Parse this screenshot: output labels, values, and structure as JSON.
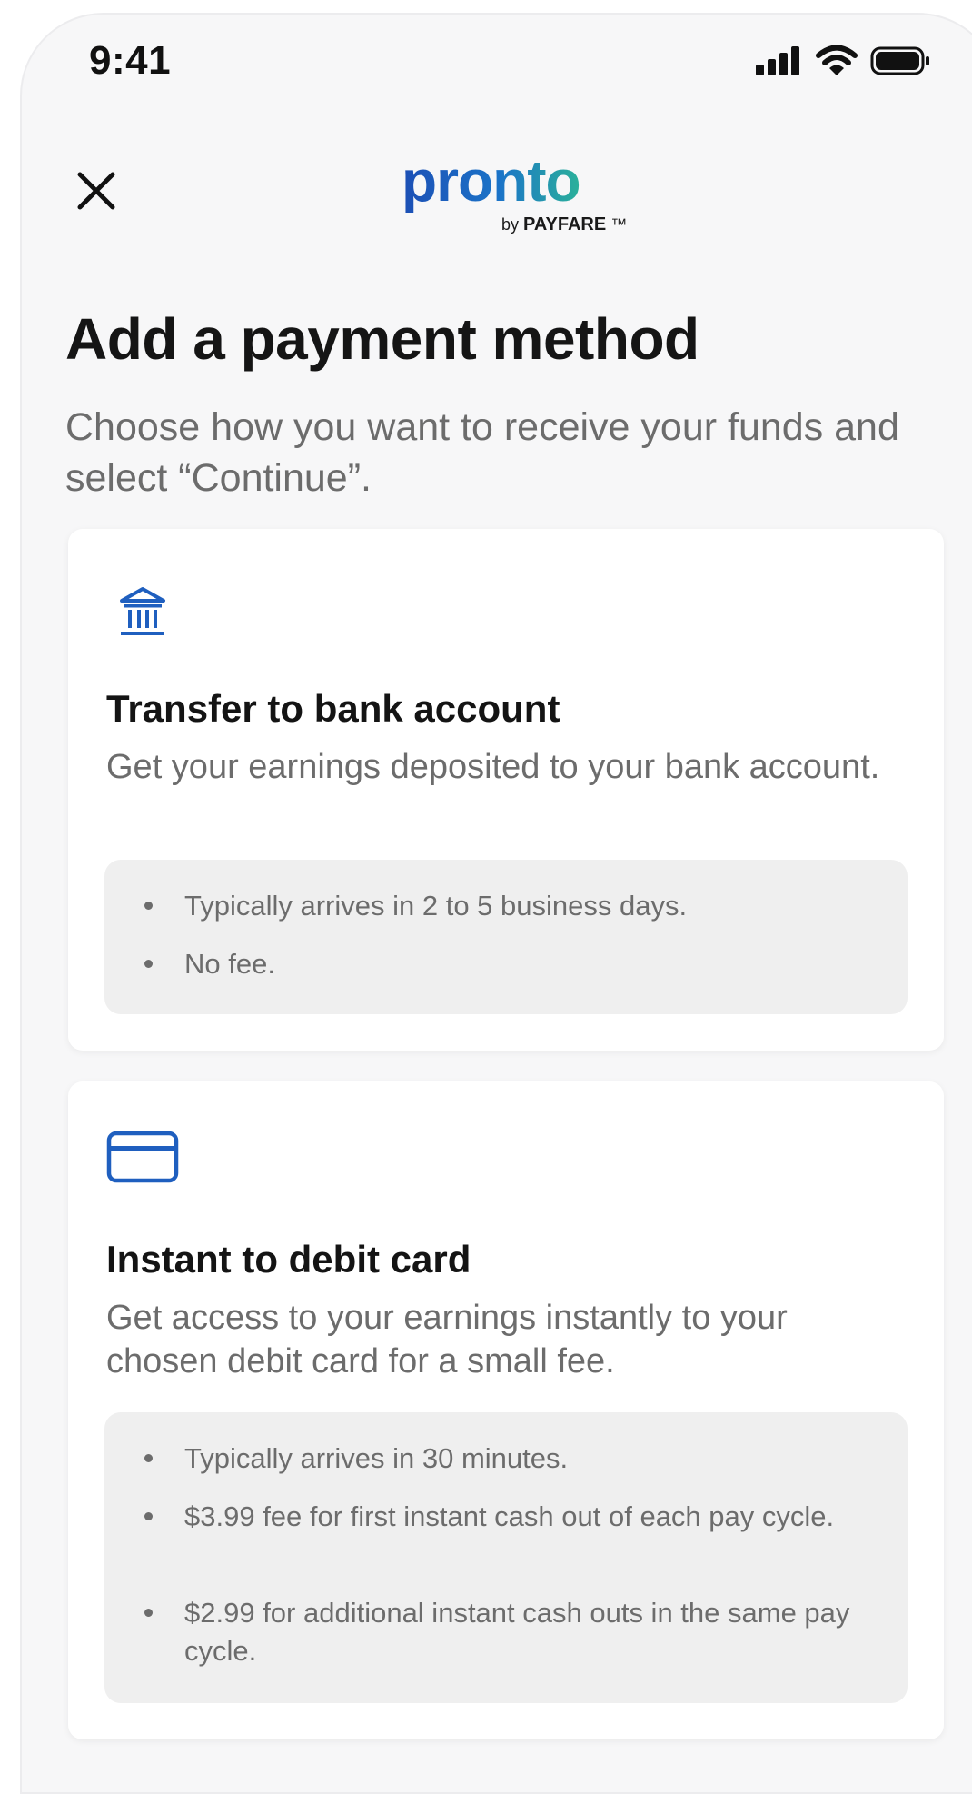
{
  "status_bar": {
    "time": "9:41",
    "icons": [
      "signal-icon",
      "wifi-icon",
      "battery-icon"
    ]
  },
  "header": {
    "close_icon": "close-icon",
    "logo_text": "pronto",
    "logo_by": "by",
    "logo_company": "PAYFARE",
    "logo_tm": "™"
  },
  "page": {
    "title": "Add a payment method",
    "subtitle": "Choose how you want to receive your funds and select “Continue”."
  },
  "options": {
    "bank": {
      "icon": "bank-icon",
      "title": "Transfer to bank account",
      "description": "Get your earnings deposited to your bank account.",
      "bullets": [
        "Typically arrives in 2 to 5 business days.",
        "No fee."
      ]
    },
    "debit": {
      "icon": "credit-card-icon",
      "title": "Instant to debit card",
      "description": "Get access to your earnings instantly to your chosen debit card for a small fee.",
      "bullets": [
        "Typically arrives in 30 minutes.",
        "$3.99 fee for first instant cash out of each pay cycle.",
        "$2.99 for additional instant cash outs in the same pay cycle."
      ]
    }
  },
  "colors": {
    "brand_blue": "#1c4fb5",
    "brand_teal": "#2bb19a",
    "icon_blue": "#1f5fbf",
    "text_primary": "#151515",
    "text_secondary": "#6c6c6c",
    "info_bg": "#efefef"
  }
}
